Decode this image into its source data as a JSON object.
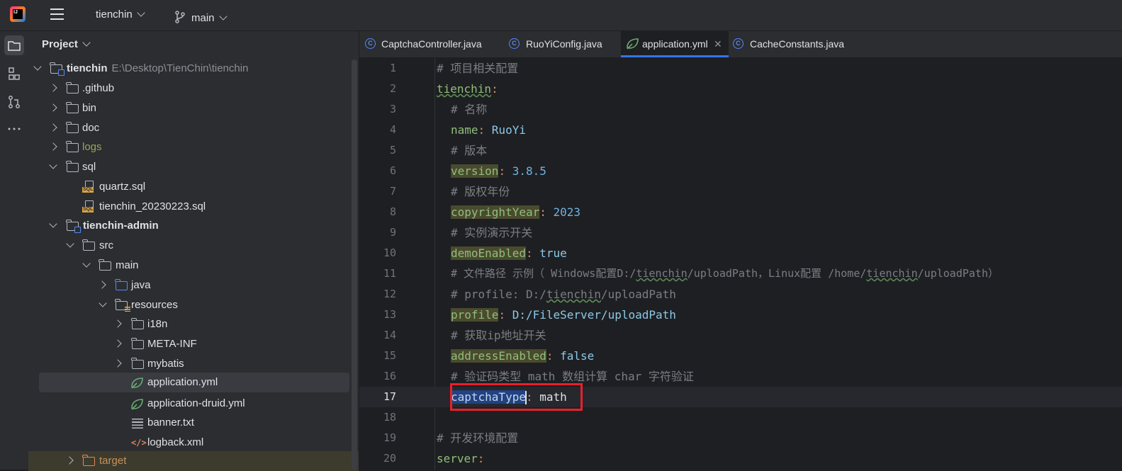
{
  "topbar": {
    "project_name": "tienchin",
    "branch": "main"
  },
  "project_panel": {
    "title": "Project",
    "tree": [
      {
        "label": "tienchin",
        "path": "E:\\Desktop\\TienChin\\tienchin"
      },
      {
        "label": ".github"
      },
      {
        "label": "bin"
      },
      {
        "label": "doc"
      },
      {
        "label": "logs"
      },
      {
        "label": "sql"
      },
      {
        "label": "quartz.sql"
      },
      {
        "label": "tienchin_20230223.sql"
      },
      {
        "label": "tienchin-admin"
      },
      {
        "label": "src"
      },
      {
        "label": "main"
      },
      {
        "label": "java"
      },
      {
        "label": "resources"
      },
      {
        "label": "i18n"
      },
      {
        "label": "META-INF"
      },
      {
        "label": "mybatis"
      },
      {
        "label": "application.yml"
      },
      {
        "label": "application-druid.yml"
      },
      {
        "label": "banner.txt"
      },
      {
        "label": "logback.xml"
      },
      {
        "label": "target"
      }
    ]
  },
  "tabs": [
    {
      "label": "CaptchaController.java"
    },
    {
      "label": "RuoYiConfig.java"
    },
    {
      "label": "application.yml",
      "close": "✕"
    },
    {
      "label": "CacheConstants.java"
    }
  ],
  "editor": {
    "current_line": 17,
    "lines": [
      {
        "n": "1",
        "comment": "# 项目相关配置"
      },
      {
        "n": "2",
        "key": "tienchin"
      },
      {
        "n": "3",
        "comment": "# 名称"
      },
      {
        "n": "4",
        "key": "name",
        "value": "RuoYi"
      },
      {
        "n": "5",
        "comment": "# 版本"
      },
      {
        "n": "6",
        "key": "version",
        "value": "3.8.5"
      },
      {
        "n": "7",
        "comment": "# 版权年份"
      },
      {
        "n": "8",
        "key": "copyrightYear",
        "value": "2023"
      },
      {
        "n": "9",
        "comment": "# 实例演示开关"
      },
      {
        "n": "10",
        "key": "demoEnabled",
        "value": "true"
      },
      {
        "n": "11",
        "comment_a": "# 文件路径 示例（ Windows配置D:/",
        "comment_b": "tienchin",
        "comment_c": "/uploadPath，Linux配置 /home/",
        "comment_d": "tienchin",
        "comment_e": "/uploadPath）"
      },
      {
        "n": "12",
        "comment_a": "# profile: D:/",
        "comment_b": "tienchin",
        "comment_c": "/uploadPath"
      },
      {
        "n": "13",
        "key": "profile",
        "value": "D:/FileServer/uploadPath"
      },
      {
        "n": "14",
        "comment": "# 获取ip地址开关"
      },
      {
        "n": "15",
        "key": "addressEnabled",
        "value": "false"
      },
      {
        "n": "16",
        "comment": "# 验证码类型 math 数组计算 char 字符验证"
      },
      {
        "n": "17",
        "key": "captchaType",
        "value": "math"
      },
      {
        "n": "18"
      },
      {
        "n": "19",
        "comment": "# 开发环境配置"
      },
      {
        "n": "20",
        "key": "server"
      }
    ]
  },
  "colors": {
    "accent": "#3574f0",
    "highlight_box": "#e8202a"
  }
}
